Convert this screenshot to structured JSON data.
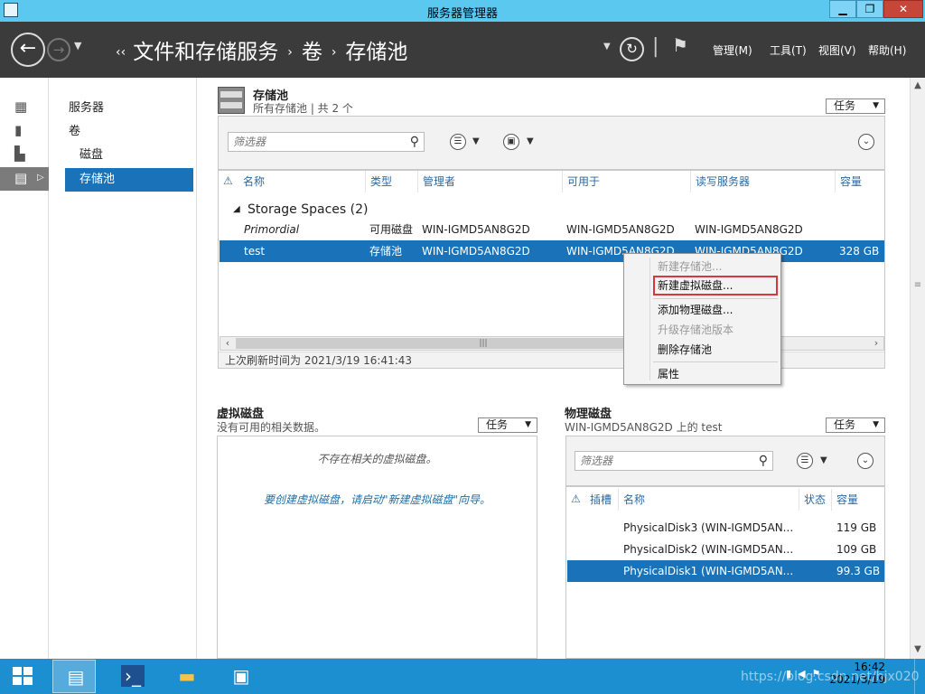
{
  "window": {
    "title": "服务器管理器",
    "min": "▁",
    "max": "❐",
    "close": "✕"
  },
  "header": {
    "breadcrumb": [
      "文件和存储服务",
      "卷",
      "存储池"
    ],
    "menu": [
      "管理(M)",
      "工具(T)",
      "视图(V)",
      "帮助(H)"
    ]
  },
  "rail_icons": [
    "dashboard-icon",
    "server-icon",
    "all-servers-icon",
    "file-storage-icon"
  ],
  "nav": {
    "items": [
      "服务器",
      "卷",
      "磁盘",
      "存储池"
    ],
    "active_index": 3
  },
  "storage_pools": {
    "title": "存储池",
    "subtitle": "所有存储池 | 共 2 个",
    "tasks_label": "任务",
    "filter_placeholder": "筛选器",
    "columns": [
      "名称",
      "类型",
      "管理者",
      "可用于",
      "读写服务器",
      "容量"
    ],
    "group": "Storage Spaces (2)",
    "rows": [
      {
        "name": "Primordial",
        "type": "可用磁盘",
        "managed_by": "WIN-IGMD5AN8G2D",
        "available_to": "WIN-IGMD5AN8G2D",
        "rw_server": "WIN-IGMD5AN8G2D",
        "capacity": "",
        "selected": false
      },
      {
        "name": "test",
        "type": "存储池",
        "managed_by": "WIN-IGMD5AN8G2D",
        "available_to": "WIN-IGMD5AN8G2D",
        "rw_server": "WIN-IGMD5AN8G2D",
        "capacity": "328 GB",
        "selected": true
      }
    ],
    "last_refresh": "上次刷新时间为 2021/3/19 16:41:43"
  },
  "context_menu": {
    "items": [
      {
        "label": "新建存储池...",
        "disabled": true
      },
      {
        "label": "新建虚拟磁盘...",
        "disabled": false,
        "highlighted": true
      },
      {
        "label": "添加物理磁盘...",
        "disabled": false
      },
      {
        "label": "升级存储池版本",
        "disabled": true
      },
      {
        "label": "删除存储池",
        "disabled": false
      },
      {
        "label": "属性",
        "disabled": false
      }
    ]
  },
  "virtual_disks": {
    "title": "虚拟磁盘",
    "subtitle": "没有可用的相关数据。",
    "tasks_label": "任务",
    "empty_text": "不存在相关的虚拟磁盘。",
    "hint_text": "要创建虚拟磁盘，请启动\"新建虚拟磁盘\"向导。"
  },
  "physical_disks": {
    "title": "物理磁盘",
    "subtitle": "WIN-IGMD5AN8G2D 上的 test",
    "tasks_label": "任务",
    "filter_placeholder": "筛选器",
    "columns": [
      "插槽",
      "名称",
      "状态",
      "容量"
    ],
    "rows": [
      {
        "name": "PhysicalDisk3 (WIN-IGMD5AN...",
        "capacity": "119 GB",
        "selected": false
      },
      {
        "name": "PhysicalDisk2 (WIN-IGMD5AN...",
        "capacity": "109 GB",
        "selected": false
      },
      {
        "name": "PhysicalDisk1 (WIN-IGMD5AN...",
        "capacity": "99.3 GB",
        "selected": true
      }
    ]
  },
  "taskbar": {
    "apps": [
      "server-manager-icon",
      "powershell-icon",
      "file-explorer-icon",
      "control-panel-icon"
    ],
    "time": "16:42",
    "date": "2021/3/19",
    "watermark": "https://blog.csdn.net/hjx020"
  },
  "colors": {
    "title_bar": "#5bc8f0",
    "header": "#3b3b3b",
    "selection": "#1a73b8",
    "taskbar": "#1b8fd0",
    "highlight_border": "#d9363e"
  }
}
